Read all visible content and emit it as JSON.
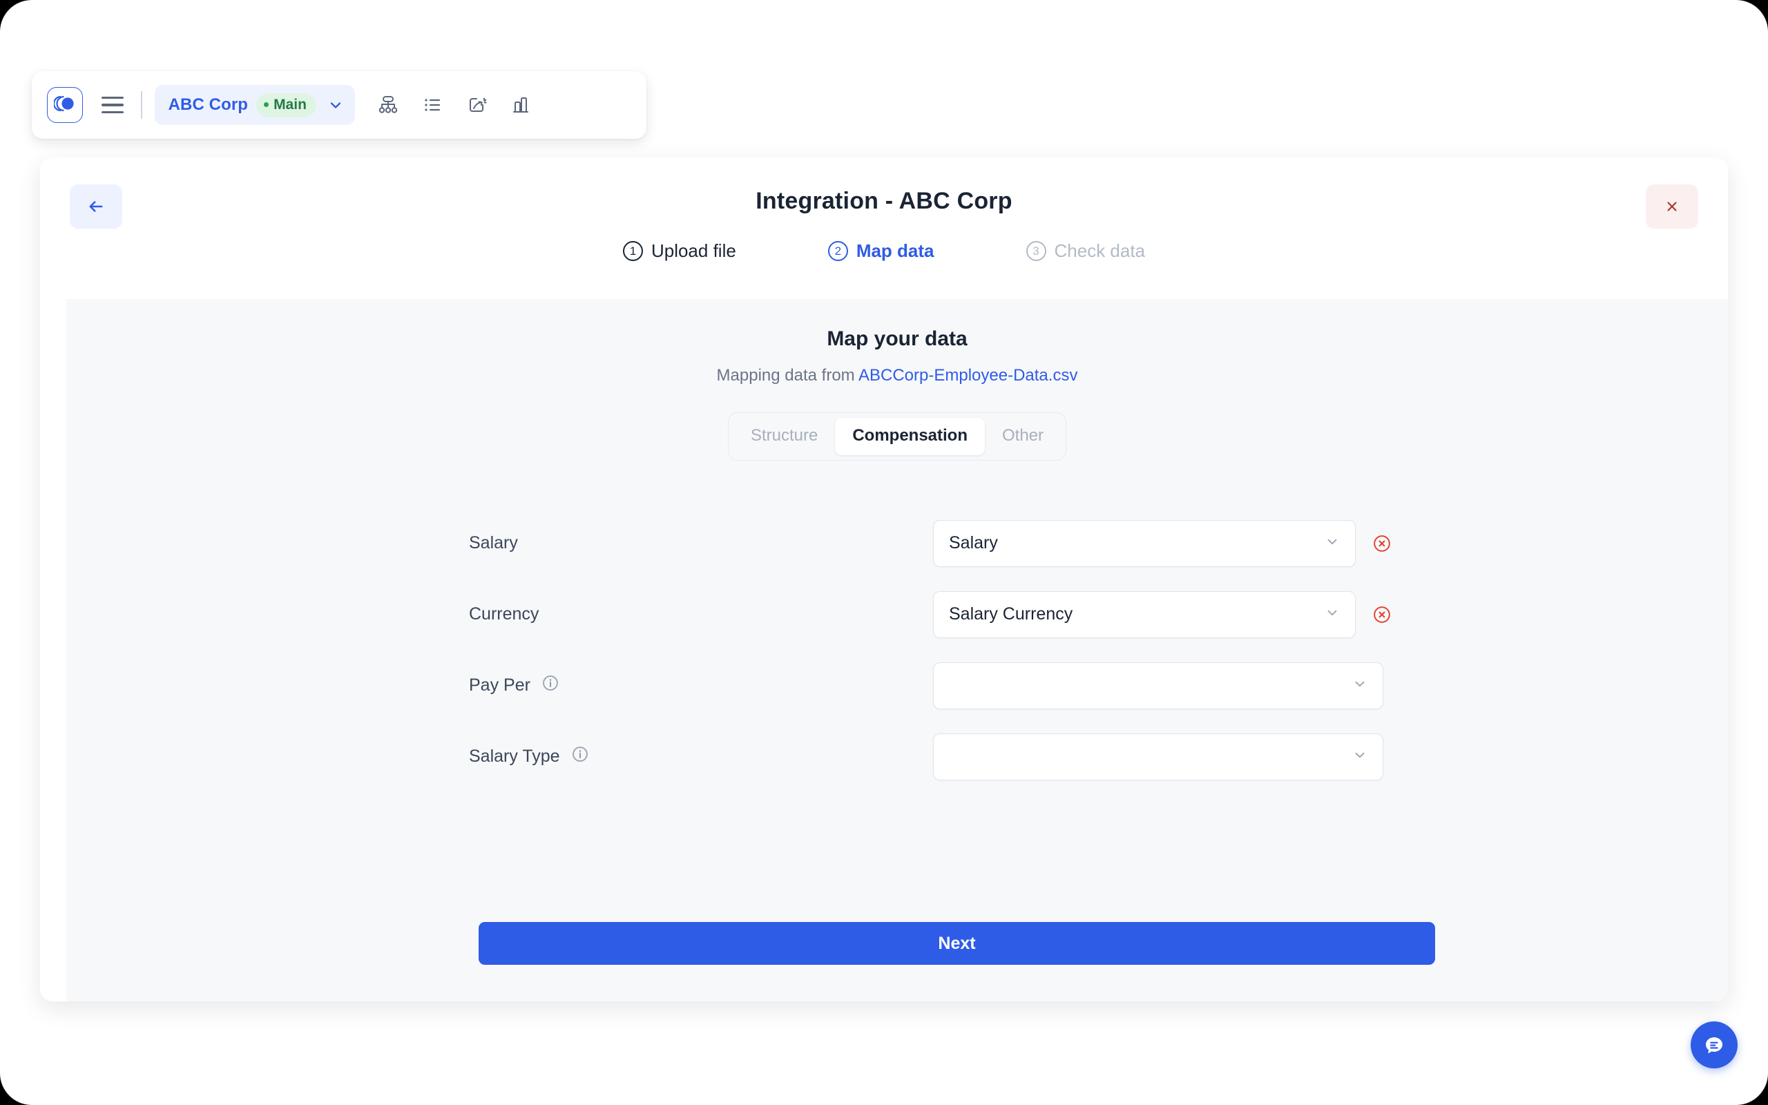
{
  "appbar": {
    "logo_icon": "stacked-circles-logo",
    "menu_icon": "hamburger-menu-icon",
    "org_name": "ABC Corp",
    "branch_name": "Main",
    "org_chevron_icon": "chevron-down-icon",
    "tools": [
      {
        "name": "org-chart-icon",
        "title": "Org chart"
      },
      {
        "name": "list-view-icon",
        "title": "List view"
      },
      {
        "name": "scenario-icon",
        "title": "Scenario"
      },
      {
        "name": "analytics-icon",
        "title": "Analytics"
      }
    ]
  },
  "modal": {
    "title": "Integration - ABC Corp",
    "back_icon": "arrow-left-icon",
    "close_icon": "close-icon",
    "steps": [
      {
        "num": "1",
        "label": "Upload file",
        "state": "done"
      },
      {
        "num": "2",
        "label": "Map data",
        "state": "active"
      },
      {
        "num": "3",
        "label": "Check data",
        "state": "todo"
      }
    ]
  },
  "panel": {
    "title": "Map your data",
    "subtitle_prefix": "Mapping data from ",
    "source_file": "ABCCorp-Employee-Data.csv",
    "tabs": [
      {
        "label": "Structure",
        "selected": false
      },
      {
        "label": "Compensation",
        "selected": true
      },
      {
        "label": "Other",
        "selected": false
      }
    ],
    "fields": [
      {
        "label": "Salary",
        "has_info": false,
        "value": "Salary",
        "placeholder": "",
        "clearable": true,
        "chevron_icon": "chevron-down-icon",
        "clear_icon": "clear-circle-icon"
      },
      {
        "label": "Currency",
        "has_info": false,
        "value": "Salary Currency",
        "placeholder": "",
        "clearable": true,
        "chevron_icon": "chevron-down-icon",
        "clear_icon": "clear-circle-icon"
      },
      {
        "label": "Pay Per",
        "has_info": true,
        "info_icon": "info-icon",
        "value": "",
        "placeholder": "",
        "clearable": false,
        "chevron_icon": "chevron-down-icon"
      },
      {
        "label": "Salary Type",
        "has_info": true,
        "info_icon": "info-icon",
        "value": "",
        "placeholder": "",
        "clearable": false,
        "chevron_icon": "chevron-down-icon"
      }
    ],
    "next_label": "Next"
  },
  "chat": {
    "icon": "chat-bubble-icon"
  },
  "colors": {
    "brand_blue": "#2f5ce6",
    "branch_green": "#257a45",
    "danger_red": "#c0392b",
    "panel_bg": "#f7f8fa",
    "text_dark": "#1b2434",
    "text_muted": "#6b7486"
  }
}
